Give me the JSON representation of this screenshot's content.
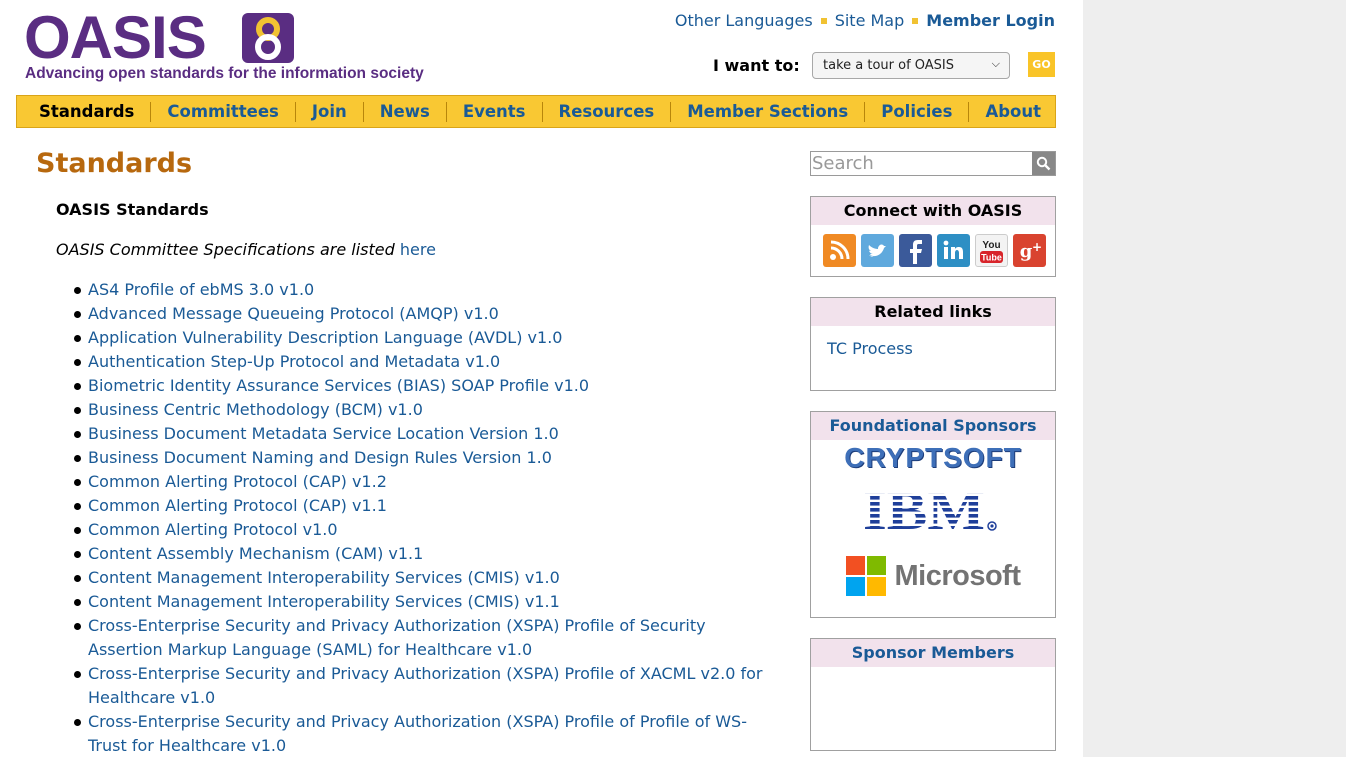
{
  "logo": {
    "wordmark": "OASIS",
    "tagline": "Advancing open standards for the information society"
  },
  "top_links": {
    "languages": "Other Languages",
    "sitemap": "Site Map",
    "login": "Member Login"
  },
  "i_want": {
    "label": "I want to:",
    "selected": "take a tour of OASIS",
    "go": "GO"
  },
  "nav": {
    "items": [
      "Standards",
      "Committees",
      "Join",
      "News",
      "Events",
      "Resources",
      "Member Sections",
      "Policies",
      "About"
    ],
    "active": "Standards"
  },
  "main": {
    "title": "Standards",
    "subtitle": "OASIS Standards",
    "cs_note": "OASIS Committee Specifications are listed ",
    "cs_link": "here",
    "standards": [
      "AS4 Profile of ebMS 3.0 v1.0",
      "Advanced Message Queueing Protocol (AMQP) v1.0",
      "Application Vulnerability Description Language (AVDL) v1.0",
      "Authentication Step-Up Protocol and Metadata v1.0",
      "Biometric Identity Assurance Services (BIAS) SOAP Profile v1.0",
      "Business Centric Methodology (BCM) v1.0",
      "Business Document Metadata Service Location Version 1.0",
      "Business Document Naming and Design Rules Version 1.0",
      "Common Alerting Protocol (CAP) v1.2",
      "Common Alerting Protocol (CAP) v1.1",
      "Common Alerting Protocol v1.0",
      "Content Assembly Mechanism (CAM) v1.1",
      "Content Management Interoperability Services (CMIS) v1.0",
      "Content Management Interoperability Services (CMIS) v1.1",
      "Cross-Enterprise Security and Privacy Authorization (XSPA) Profile of Security Assertion Markup Language (SAML) for Healthcare v1.0",
      "Cross-Enterprise Security and Privacy Authorization (XSPA) Profile of XACML v2.0 for Healthcare v1.0",
      "Cross-Enterprise Security and Privacy Authorization (XSPA) Profile of Profile of WS-Trust for Healthcare v1.0"
    ]
  },
  "sidebar": {
    "search_placeholder": "Search",
    "connect_title": "Connect with OASIS",
    "social": [
      "rss-icon",
      "twitter-icon",
      "facebook-icon",
      "linkedin-icon",
      "youtube-icon",
      "google-plus-icon"
    ],
    "related_title": "Related links",
    "related_links": [
      "TC Process"
    ],
    "foundational_title": "Foundational Sponsors",
    "foundational": [
      "CRYPTSOFT",
      "IBM",
      "Microsoft"
    ],
    "sponsor_members_title": "Sponsor Members"
  },
  "colors": {
    "brand_purple": "#5a2d82",
    "nav_yellow": "#f9c833",
    "link_blue": "#1a5a96",
    "title_orange": "#b7680e",
    "box_head_pink": "#f2e2ec"
  }
}
